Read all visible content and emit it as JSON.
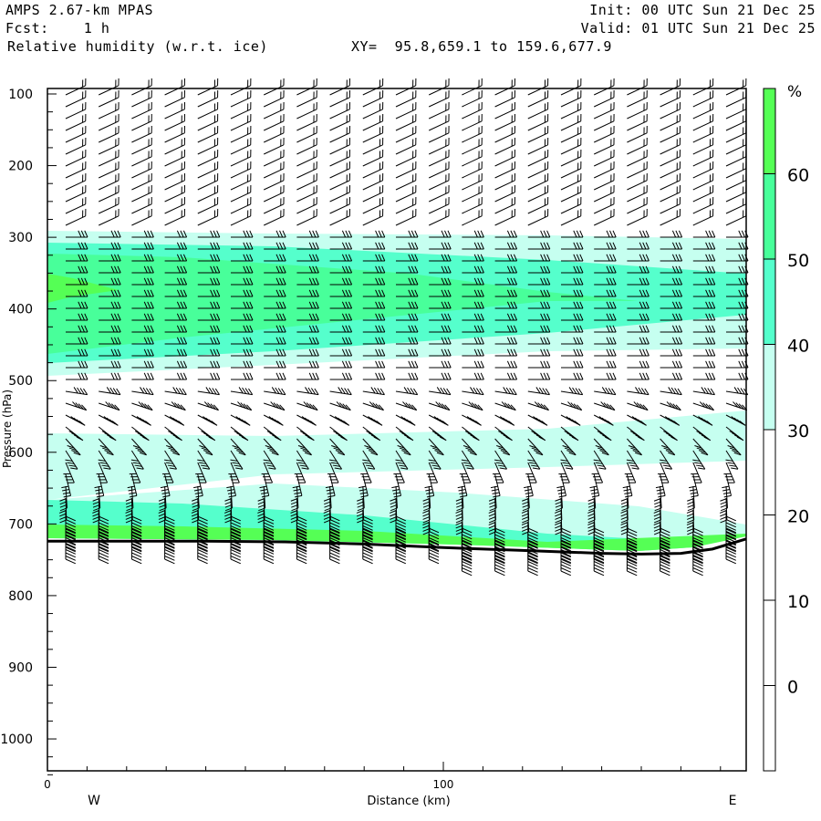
{
  "header": {
    "model": "AMPS 2.67-km MPAS",
    "fcst": "Fcst:    1 h",
    "field": "Relative humidity (w.r.t. ice)",
    "xy": "XY=  95.8,659.1 to 159.6,677.9",
    "init": "Init: 00 UTC Sun 21 Dec 25",
    "valid": "Valid: 01 UTC Sun 21 Dec 25"
  },
  "chart_data": {
    "type": "cross-section",
    "title": "Relative humidity (w.r.t. ice)",
    "xlabel": "Distance (km)",
    "ylabel": "Pressure (hPa)",
    "xlim": [
      0,
      176.5
    ],
    "ylim": [
      1050,
      100
    ],
    "x_ticks": [
      "0",
      "100"
    ],
    "x_tick_values": [
      0,
      100
    ],
    "y_ticks": [
      "100",
      "200",
      "300",
      "400",
      "500",
      "600",
      "700",
      "800",
      "900",
      "1000"
    ],
    "y_tick_values": [
      100,
      200,
      300,
      400,
      500,
      600,
      700,
      800,
      900,
      1000
    ],
    "left_end_label": "W",
    "right_end_label": "E",
    "colorbar": {
      "unit": "%",
      "levels": [
        "60",
        "50",
        "40",
        "30",
        "20",
        "10",
        "0"
      ],
      "colors": [
        "#55ff55",
        "#48ff9a",
        "#55ffcc",
        "#c6fff0",
        "#ffffff",
        "#ffffff",
        "#ffffff",
        "#ffffff"
      ]
    },
    "terrain_pressure": {
      "distance_km": [
        0,
        20,
        40,
        60,
        80,
        100,
        120,
        140,
        150,
        160,
        168,
        176.5
      ],
      "hPa": [
        724,
        724,
        724,
        725,
        728,
        733,
        737,
        741,
        742,
        741,
        735,
        721
      ]
    }
  }
}
